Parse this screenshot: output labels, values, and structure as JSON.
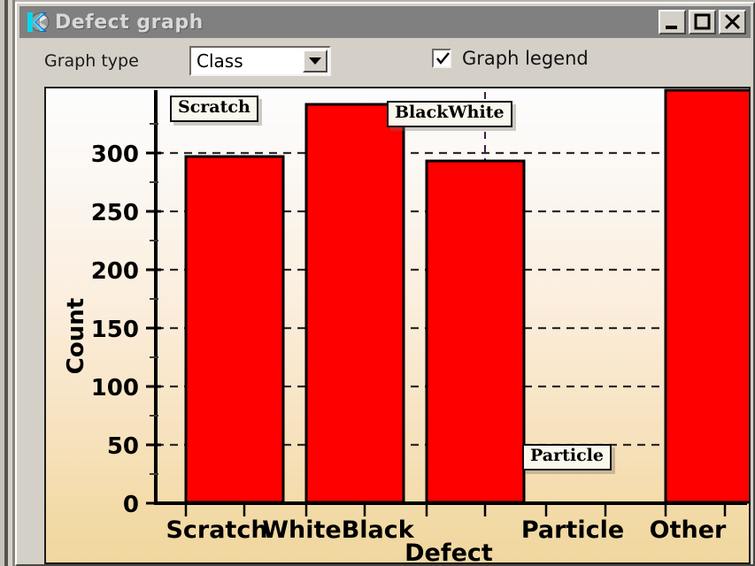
{
  "window": {
    "title": "Defect graph",
    "icon": "k-logo-icon",
    "controls": {
      "minimize": "minimize-icon",
      "maximize": "maximize-icon",
      "close": "close-icon"
    }
  },
  "toolbar": {
    "graph_type_label": "Graph type",
    "graph_type_value": "Class",
    "graph_type_options": [
      "Class"
    ],
    "legend_label": "Graph legend",
    "legend_checked": true,
    "dropdown_icon": "chevron-down-icon",
    "check_icon": "check-icon"
  },
  "chart_data": {
    "type": "bar",
    "title": "",
    "xlabel": "Defect",
    "ylabel": "Count",
    "categories": [
      "Scratch",
      "WhiteBlack",
      "",
      "Particle",
      "Other"
    ],
    "values": [
      295,
      347,
      291,
      0,
      352
    ],
    "ylim": [
      0,
      350
    ],
    "yticks": [
      0,
      50,
      100,
      150,
      200,
      250,
      300
    ],
    "ytick_labels": [
      "0",
      "50",
      "100",
      "150",
      "200",
      "250",
      "300"
    ],
    "grid": true,
    "bar_color": "#fe0000",
    "bar_edge_color": "#000000",
    "legend_position": "inside-callouts",
    "annotations": [
      {
        "text": "Scratch",
        "category": "Scratch"
      },
      {
        "text": "BlackWhite",
        "category": "WhiteBlack"
      },
      {
        "text": "Particle",
        "category": "Particle"
      }
    ],
    "plot_bg_top": "#fdfdfd",
    "plot_bg_bottom": "#f0d79e"
  }
}
